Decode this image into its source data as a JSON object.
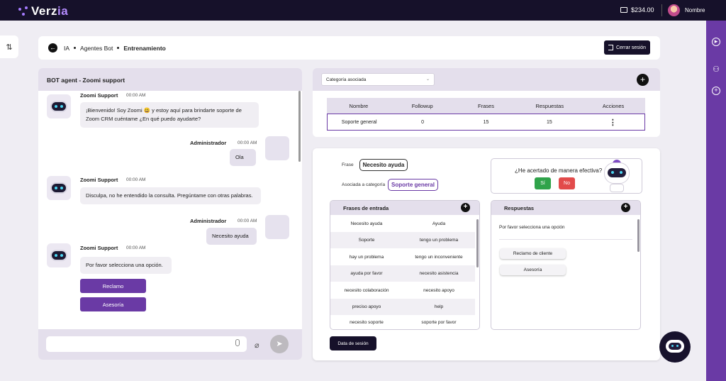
{
  "brand": {
    "logo_text": "Verz",
    "logo_accent": "ia",
    "accent_color": "#6a3aa5"
  },
  "topbar": {
    "balance": "$234.00",
    "user_name": "Nombre"
  },
  "header": {
    "breadcrumb": [
      "IA",
      "Agentes Bot",
      "Entrenamiento"
    ],
    "logout_label": "Cerrar sesión"
  },
  "chat": {
    "title": "BOT agent - Zoomi support",
    "messages": [
      {
        "sender": "Zoomi Support",
        "time": "00:00 AM",
        "text": "¡Bienvenido! Soy Zoomi 😃 y estoy aquí para brindarte soporte de Zoom CRM cuéntame ¿En qué puedo ayudarte?"
      },
      {
        "sender": "Administrador",
        "time": "00:00 AM",
        "text": "Ola"
      },
      {
        "sender": "Zoomi Support",
        "time": "00:00 AM",
        "text": "Disculpa, no he entendido la consulta. Pregúntame con otras palabras."
      },
      {
        "sender": "Administrador",
        "time": "00:00 AM",
        "text": "Necesito ayuda"
      },
      {
        "sender": "Zoomi Support",
        "time": "00:00 AM",
        "text": "Por favor selecciona una opción."
      }
    ],
    "options": [
      "Reclamo",
      "Asesoría"
    ],
    "input_placeholder": ""
  },
  "category": {
    "select_value": "Categoría asociada",
    "columns": [
      "Nombre",
      "Followup",
      "Frases",
      "Respuestas",
      "Acciones"
    ],
    "rows": [
      {
        "nombre": "Soporte general",
        "followup": "0",
        "frases": "15",
        "respuestas": "15",
        "acciones": "⋮"
      }
    ]
  },
  "training": {
    "frase_label": "Frase",
    "frase_value": "Necesito ayuda",
    "categoria_label": "Asociada a categoría",
    "categoria_value": "Soporte general",
    "effectiveness_question": "¿He acertado de manera efectiva?",
    "yes_label": "Sí",
    "no_label": "No",
    "frases_title": "Frases de entrada",
    "frases": [
      [
        "Necesito ayuda",
        "Ayuda"
      ],
      [
        "Soporte",
        "tengo un problema"
      ],
      [
        "hay un problema",
        "tengo un inconveniente"
      ],
      [
        "ayuda por favor",
        "necesito asistencia"
      ],
      [
        "necesito colaboración",
        "necesito apoyo"
      ],
      [
        "preciso apoyo",
        "help"
      ],
      [
        "necesito soporte",
        "soporte por favor"
      ]
    ],
    "respuestas_title": "Respuestas",
    "respuesta_text": "Por favor selecciona una opción",
    "respuesta_buttons": [
      "Reclamo de cliente",
      "Asesoría"
    ],
    "session_button": "Data de sesión"
  }
}
